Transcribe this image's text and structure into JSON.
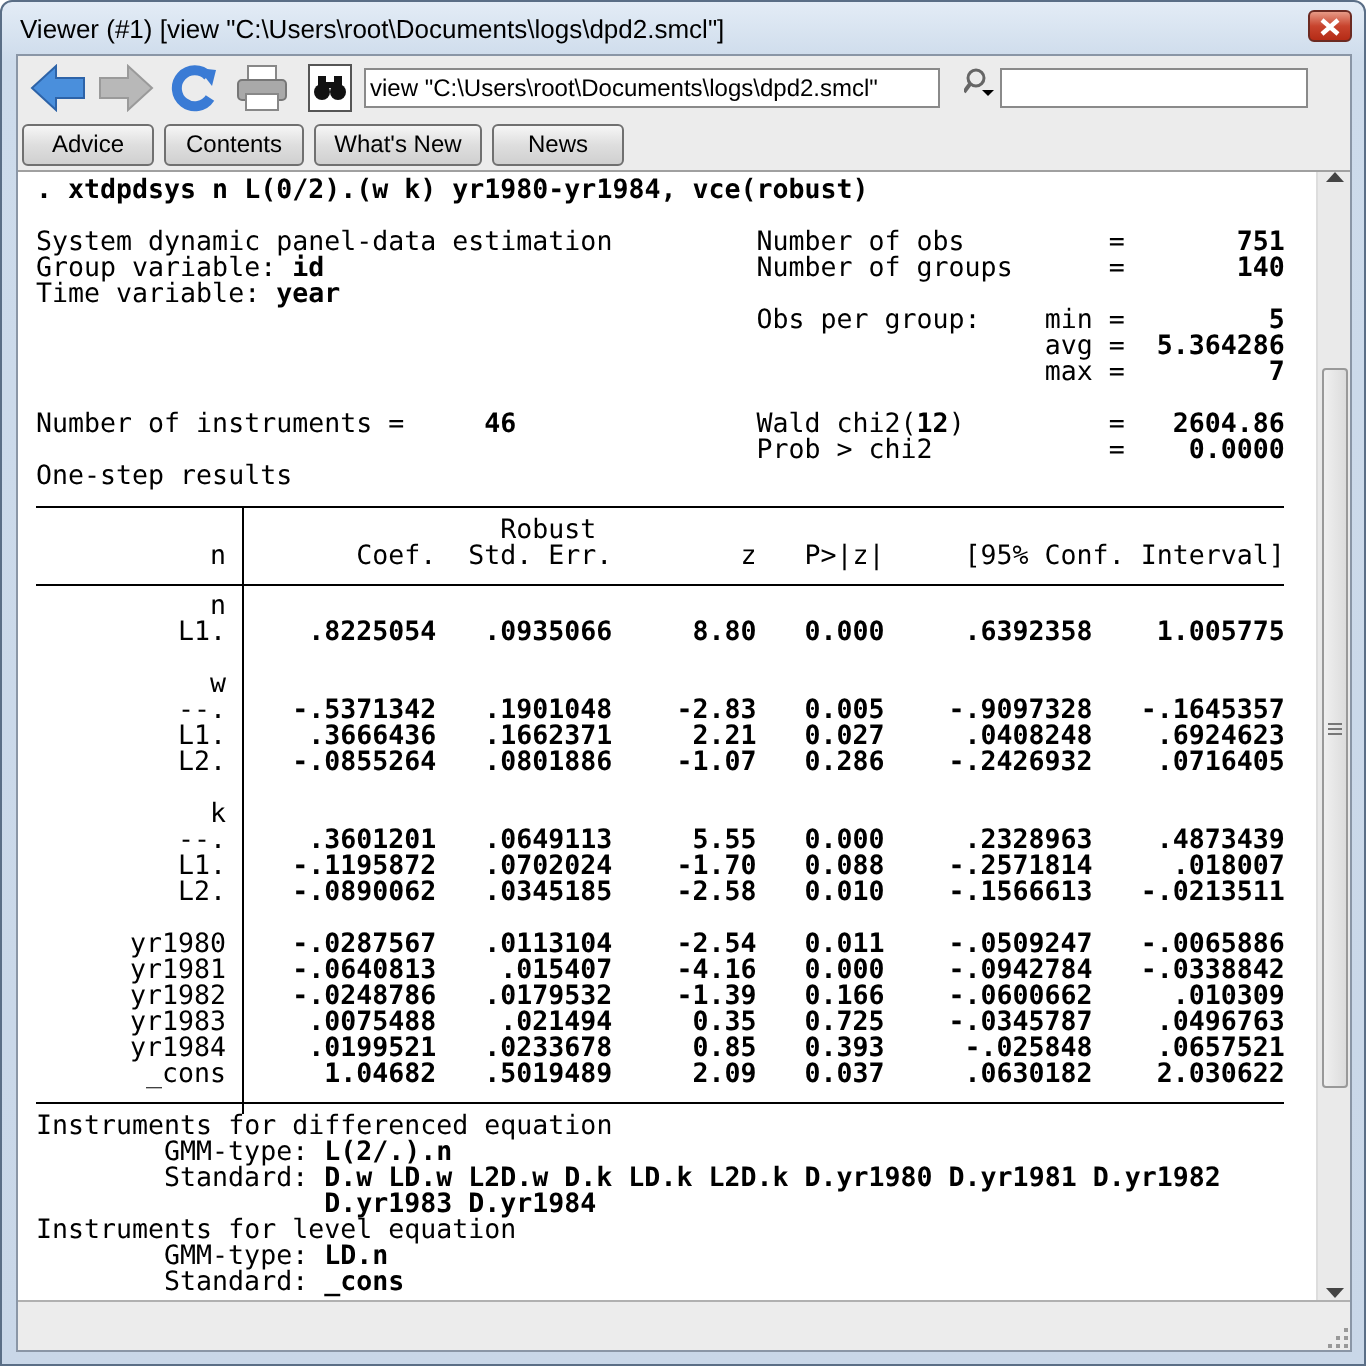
{
  "window": {
    "title": "Viewer (#1) [view \"C:\\Users\\root\\Documents\\logs\\dpd2.smcl\"]"
  },
  "toolbar": {
    "address": "view \"C:\\Users\\root\\Documents\\logs\\dpd2.smcl\""
  },
  "buttons": [
    "Advice",
    "Contents",
    "What's New",
    "News"
  ],
  "log": {
    "command": ". xtdpdsys n L(0/2).(w k) yr1980-yr1984, vce(robust)",
    "info": [
      {
        "label": "System dynamic panel-data estimation"
      },
      {
        "label": "Group variable:",
        "value": "id"
      },
      {
        "label": "Time variable:",
        "value": "year"
      }
    ],
    "stats": [
      {
        "label": "Number of obs",
        "eq": "=",
        "value": "751"
      },
      {
        "label": "Number of groups",
        "eq": "=",
        "value": "140"
      }
    ],
    "obs_per_group": {
      "label": "Obs per group:",
      "items": [
        {
          "label": "min",
          "eq": "=",
          "value": "5"
        },
        {
          "label": "avg",
          "eq": "=",
          "value": "5.364286"
        },
        {
          "label": "max",
          "eq": "=",
          "value": "7"
        }
      ]
    },
    "instruments": {
      "label": "Number of instruments =",
      "value": "46"
    },
    "tests": [
      {
        "label": "Wald chi2(**12**)",
        "eq": "=",
        "value": "2604.86"
      },
      {
        "label": "Prob > chi2",
        "eq": "=",
        "value": "0.0000"
      }
    ],
    "results_title": "One-step results",
    "table": {
      "depvar": "n",
      "super": "Robust",
      "columns": [
        "Coef.",
        "Std. Err.",
        "z",
        "P>|z|",
        "[95% Conf. Interval]"
      ],
      "groups": [
        {
          "name": "n",
          "rows": [
            {
              "label": "L1.",
              "values": [
                ".8225054",
                ".0935066",
                "8.80",
                "0.000",
                ".6392358",
                "1.005775"
              ]
            }
          ]
        },
        {
          "name": "w",
          "rows": [
            {
              "label": "--.",
              "values": [
                "-.5371342",
                ".1901048",
                "-2.83",
                "0.005",
                "-.9097328",
                "-.1645357"
              ]
            },
            {
              "label": "L1.",
              "values": [
                ".3666436",
                ".1662371",
                "2.21",
                "0.027",
                ".0408248",
                ".6924623"
              ]
            },
            {
              "label": "L2.",
              "values": [
                "-.0855264",
                ".0801886",
                "-1.07",
                "0.286",
                "-.2426932",
                ".0716405"
              ]
            }
          ]
        },
        {
          "name": "k",
          "rows": [
            {
              "label": "--.",
              "values": [
                ".3601201",
                ".0649113",
                "5.55",
                "0.000",
                ".2328963",
                ".4873439"
              ]
            },
            {
              "label": "L1.",
              "values": [
                "-.1195872",
                ".0702024",
                "-1.70",
                "0.088",
                "-.2571814",
                ".018007"
              ]
            },
            {
              "label": "L2.",
              "values": [
                "-.0890062",
                ".0345185",
                "-2.58",
                "0.010",
                "-.1566613",
                "-.0213511"
              ]
            }
          ]
        },
        {
          "rows": [
            {
              "label": "yr1980",
              "values": [
                "-.0287567",
                ".0113104",
                "-2.54",
                "0.011",
                "-.0509247",
                "-.0065886"
              ]
            },
            {
              "label": "yr1981",
              "values": [
                "-.0640813",
                ".015407",
                "-4.16",
                "0.000",
                "-.0942784",
                "-.0338842"
              ]
            },
            {
              "label": "yr1982",
              "values": [
                "-.0248786",
                ".0179532",
                "-1.39",
                "0.166",
                "-.0600662",
                ".010309"
              ]
            },
            {
              "label": "yr1983",
              "values": [
                ".0075488",
                ".021494",
                "0.35",
                "0.725",
                "-.0345787",
                ".0496763"
              ]
            },
            {
              "label": "yr1984",
              "values": [
                ".0199521",
                ".0233678",
                "0.85",
                "0.393",
                "-.025848",
                ".0657521"
              ]
            },
            {
              "label": "_cons",
              "values": [
                "1.04682",
                ".5019489",
                "2.09",
                "0.037",
                ".0630182",
                "2.030622"
              ]
            }
          ]
        }
      ]
    },
    "instrument_sets": [
      {
        "heading": "Instruments for differenced equation",
        "entries": [
          {
            "label": "GMM-type:",
            "lines": [
              "L(2/.).n"
            ]
          },
          {
            "label": "Standard:",
            "lines": [
              "D.w LD.w L2D.w D.k LD.k L2D.k D.yr1980 D.yr1981 D.yr1982",
              "D.yr1983 D.yr1984"
            ]
          }
        ]
      },
      {
        "heading": "Instruments for level equation",
        "entries": [
          {
            "label": "GMM-type:",
            "lines": [
              "LD.n"
            ]
          },
          {
            "label": "Standard:",
            "lines": [
              "_cons"
            ]
          }
        ]
      }
    ]
  }
}
